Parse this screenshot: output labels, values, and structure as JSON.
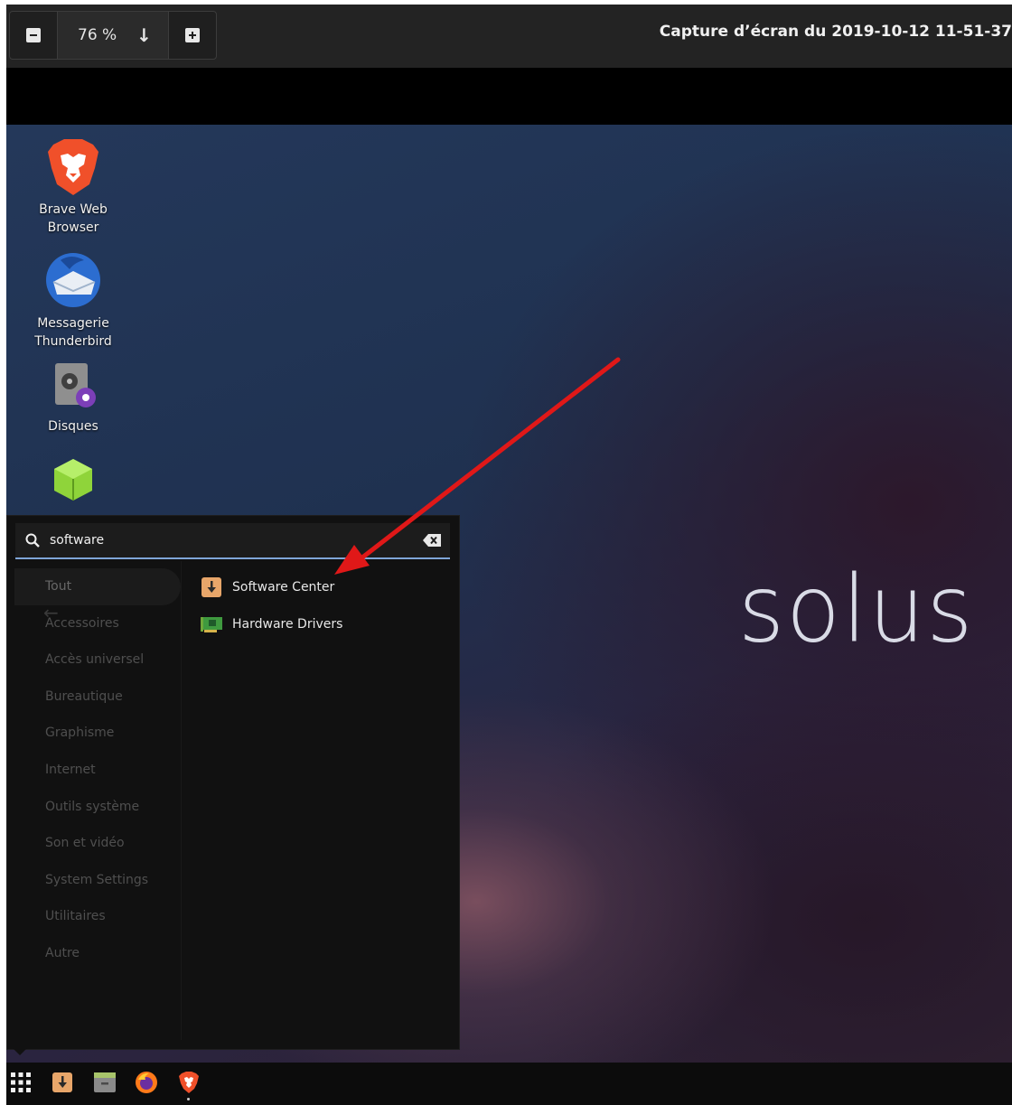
{
  "viewer": {
    "zoom_value": "76 %",
    "title": "Capture d’écran du 2019-10-12 11-51-37"
  },
  "desktop": {
    "logo_text": "solus",
    "icons": [
      {
        "label_line1": "Brave Web",
        "label_line2": "Browser",
        "icon": "brave-lion-icon"
      },
      {
        "label_line1": "Messagerie",
        "label_line2": "Thunderbird",
        "icon": "thunderbird-icon"
      },
      {
        "label_line1": "Disques",
        "label_line2": "",
        "icon": "disks-icon"
      },
      {
        "label_line1": "",
        "label_line2": "",
        "icon": "green-cube-icon"
      }
    ]
  },
  "menu": {
    "search_value": "software",
    "categories": [
      "Tout",
      "Accessoires",
      "Accès universel",
      "Bureautique",
      "Graphisme",
      "Internet",
      "Outils système",
      "Son et vidéo",
      "System Settings",
      "Utilitaires",
      "Autre"
    ],
    "results": [
      {
        "label": "Software Center",
        "icon": "software-center-icon"
      },
      {
        "label": "Hardware Drivers",
        "icon": "hardware-drivers-icon"
      }
    ]
  },
  "taskbar": {
    "items": [
      "app-grid-icon",
      "software-center-icon",
      "files-icon",
      "firefox-icon",
      "brave-icon"
    ]
  },
  "colors": {
    "search_underline": "#7fa6d8",
    "annotation_arrow": "#e01818",
    "menu_bg": "#111111"
  }
}
